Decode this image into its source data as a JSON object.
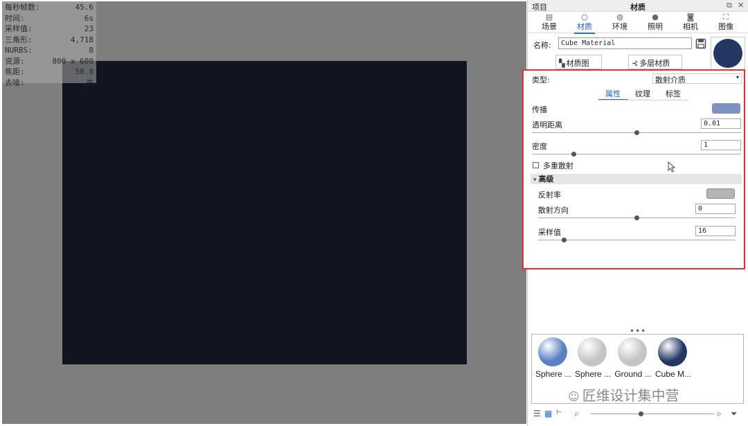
{
  "stats": [
    {
      "label": "每秒帧数:",
      "value": "45.6"
    },
    {
      "label": "时间:",
      "value": "6s"
    },
    {
      "label": "采样值:",
      "value": "23"
    },
    {
      "label": "三角形:",
      "value": "4,718"
    },
    {
      "label": "NURBS:",
      "value": "8"
    },
    {
      "label": "资源:",
      "value": "800 x 600"
    },
    {
      "label": "焦距:",
      "value": "50.0"
    },
    {
      "label": "去噪:",
      "value": "关"
    }
  ],
  "panel": {
    "left_title": "项目",
    "title": "材质",
    "restore_glyph": "⧉",
    "close_glyph": "✕"
  },
  "tabs": [
    {
      "label": "场景",
      "icon": "scene-icon",
      "glyph": "▤"
    },
    {
      "label": "材质",
      "icon": "material-icon",
      "glyph": "○"
    },
    {
      "label": "环境",
      "icon": "environment-icon",
      "glyph": "◍"
    },
    {
      "label": "照明",
      "icon": "lighting-icon",
      "glyph": "●"
    },
    {
      "label": "相机",
      "icon": "camera-icon",
      "glyph": "◙"
    },
    {
      "label": "图像",
      "icon": "image-icon",
      "glyph": "⛶"
    }
  ],
  "material": {
    "name_label": "名称:",
    "name_value": "Cube Material",
    "preview_color": "#223863",
    "graph_button": "材质图",
    "multilayer_button": "多层材质"
  },
  "properties": {
    "type_label": "类型:",
    "type_value": "散射介质",
    "subtabs": [
      "属性",
      "纹理",
      "标签"
    ],
    "propagation_label": "传播",
    "propagation_color": "#7b93c4",
    "transparency_label": "透明距离",
    "transparency_value": "0.01",
    "transparency_slider": 0.5,
    "density_label": "密度",
    "density_value": "1",
    "density_slider": 0.2,
    "multi_scatter_label": "多重散射",
    "multi_scatter_checked": false,
    "advanced_label": "高级",
    "reflectance_label": "反射率",
    "reflectance_color": "#b4b4b4",
    "scatter_dir_label": "散射方向",
    "scatter_dir_value": "0",
    "scatter_dir_slider": 0.5,
    "samples_label": "采样值",
    "samples_value": "16",
    "samples_slider": 0.13
  },
  "library": {
    "more_glyph": "•••",
    "items": [
      {
        "name": "Sphere ...",
        "color": "#5a80c4"
      },
      {
        "name": "Sphere ...",
        "color": "#c4c4c4"
      },
      {
        "name": "Ground ...",
        "color": "#c4c4c4"
      },
      {
        "name": "Cube M...",
        "color": "#223863"
      }
    ],
    "watermark": "匠维设计集中营"
  },
  "accent_color": "#2c6fd1",
  "highlight_border_color": "#e0303a"
}
